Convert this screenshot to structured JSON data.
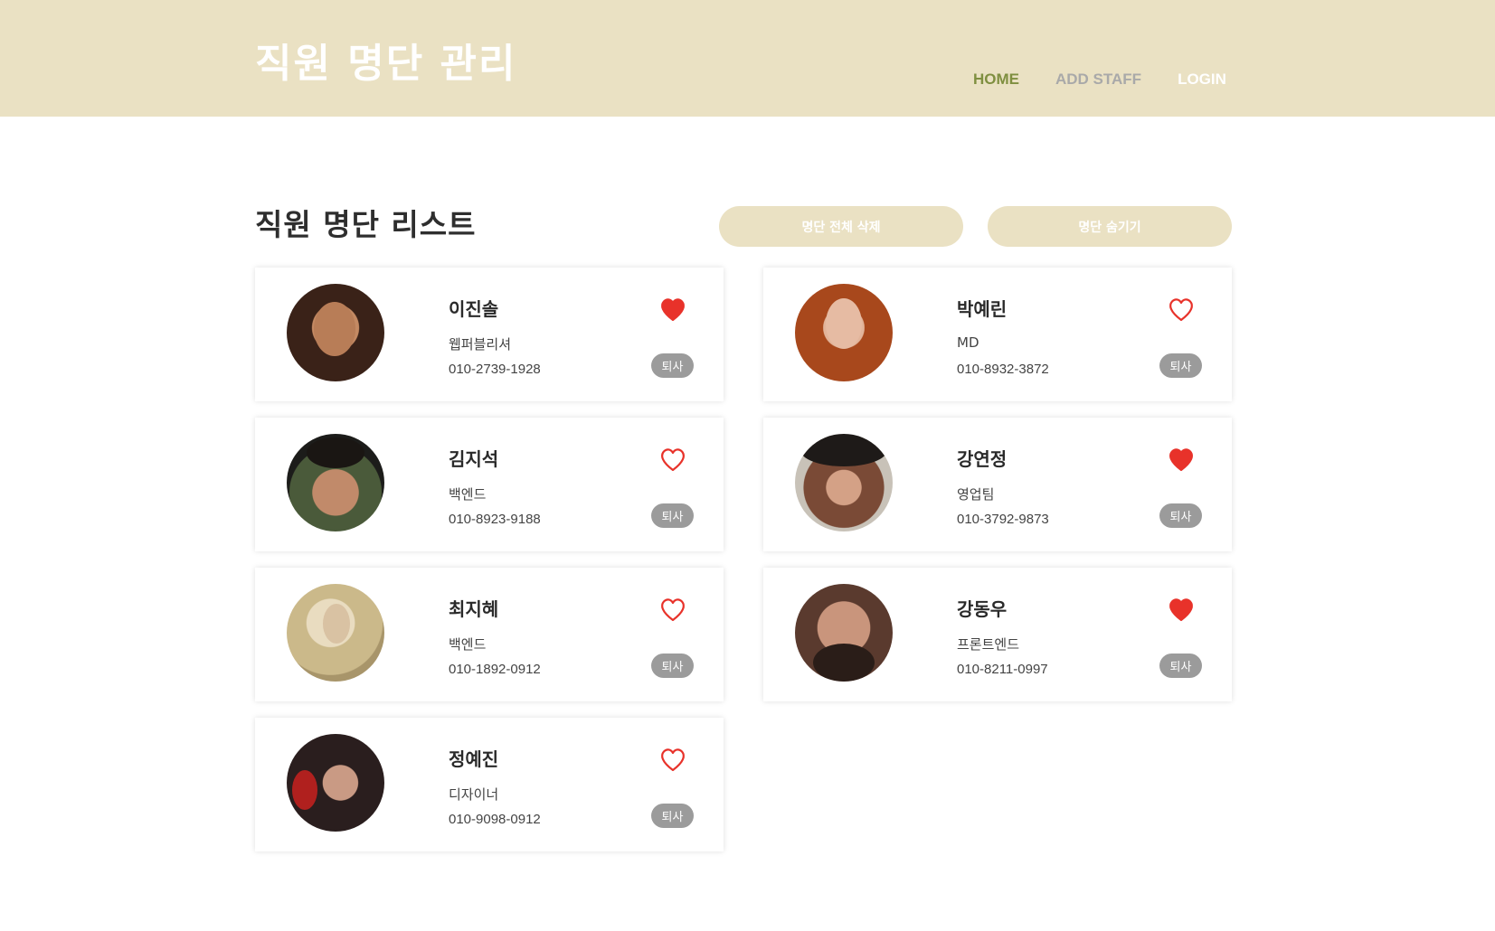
{
  "header": {
    "title": "직원 명단 관리",
    "nav": [
      {
        "label": "HOME",
        "state": "active"
      },
      {
        "label": "ADD STAFF",
        "state": "normal"
      },
      {
        "label": "LOGIN",
        "state": "muted"
      }
    ]
  },
  "main": {
    "title": "직원 명단 리스트",
    "delete_all_label": "명단 전체 삭제",
    "hide_label": "명단 숨기기"
  },
  "staff": [
    {
      "name": "이진솔",
      "role": "웹퍼블리셔",
      "phone": "010-2739-1928",
      "liked": true,
      "quit_label": "퇴사"
    },
    {
      "name": "박예린",
      "role": "MD",
      "phone": "010-8932-3872",
      "liked": false,
      "quit_label": "퇴사"
    },
    {
      "name": "김지석",
      "role": "백엔드",
      "phone": "010-8923-9188",
      "liked": false,
      "quit_label": "퇴사"
    },
    {
      "name": "강연정",
      "role": "영업팀",
      "phone": "010-3792-9873",
      "liked": true,
      "quit_label": "퇴사"
    },
    {
      "name": "최지혜",
      "role": "백엔드",
      "phone": "010-1892-0912",
      "liked": false,
      "quit_label": "퇴사"
    },
    {
      "name": "강동우",
      "role": "프론트엔드",
      "phone": "010-8211-0997",
      "liked": true,
      "quit_label": "퇴사"
    },
    {
      "name": "정예진",
      "role": "디자이너",
      "phone": "010-9098-0912",
      "liked": false,
      "quit_label": "퇴사"
    }
  ],
  "colors": {
    "header_bg": "#eae1c3",
    "nav_active": "#7f8f40",
    "heart": "#e8322a",
    "quit_badge": "#9b9b9b"
  }
}
